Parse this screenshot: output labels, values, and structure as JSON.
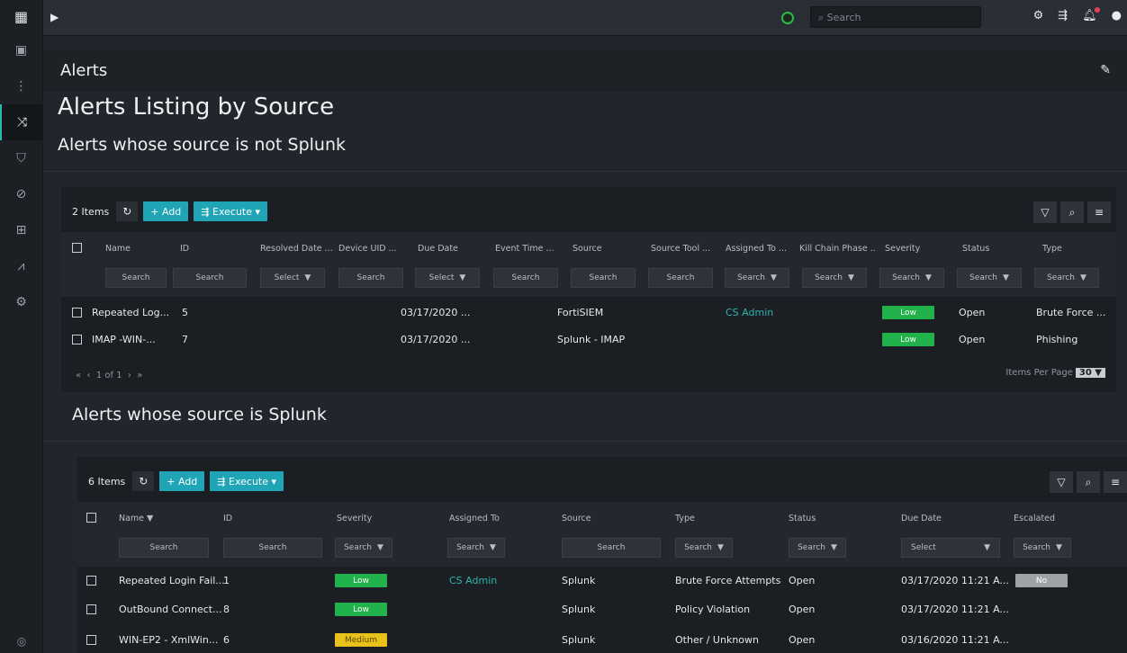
{
  "topbar": {
    "search_placeholder": "Search"
  },
  "page": {
    "title": "Alerts",
    "heading": "Alerts Listing by Source",
    "section1": "Alerts whose source is not Splunk",
    "section2": "Alerts whose source is Splunk"
  },
  "grid1": {
    "count": "2 Items",
    "add_label": "+ Add",
    "execute_label": "Execute ▾",
    "columns": [
      "Name",
      "ID",
      "Resolved Date ...",
      "Device UID ...",
      "Due Date",
      "Event Time ...",
      "Source",
      "Source Tool ...",
      "Assigned To ...",
      "Kill Chain Phase ..",
      "Severity",
      "Status",
      "Type"
    ],
    "filters": [
      "Search",
      "Search",
      "Select",
      "Search",
      "Select",
      "Search",
      "Search",
      "Search",
      "Search",
      "Search",
      "Search",
      "Search",
      "Search"
    ],
    "rows": [
      {
        "name": "Repeated Log...",
        "id": "5",
        "due": "03/17/2020 ...",
        "source": "FortiSIEM",
        "assigned": "CS Admin",
        "severity": "Low",
        "status": "Open",
        "type": "Brute Force ..."
      },
      {
        "name": "IMAP -WIN-...",
        "id": "7",
        "due": "03/17/2020 ...",
        "source": "Splunk - IMAP",
        "assigned": "",
        "severity": "Low",
        "status": "Open",
        "type": "Phishing"
      }
    ],
    "pager": "1 of 1",
    "items_per_page_label": "Items Per Page",
    "items_per_page": "30"
  },
  "grid2": {
    "count": "6 Items",
    "add_label": "+ Add",
    "execute_label": "Execute ▾",
    "columns": [
      "Name",
      "ID",
      "Severity",
      "Assigned To",
      "Source",
      "Type",
      "Status",
      "Due Date",
      "Escalated"
    ],
    "filters": [
      "Search",
      "Search",
      "Search",
      "Search",
      "Search",
      "Search",
      "Search",
      "Select",
      "Search"
    ],
    "rows": [
      {
        "name": "Repeated Login Fail...",
        "id": "1",
        "severity": "Low",
        "assigned": "CS Admin",
        "source": "Splunk",
        "type": "Brute Force Attempts",
        "status": "Open",
        "due": "03/17/2020 11:21 A...",
        "escalated": "No"
      },
      {
        "name": "OutBound Connect...",
        "id": "8",
        "severity": "Low",
        "assigned": "",
        "source": "Splunk",
        "type": "Policy Violation",
        "status": "Open",
        "due": "03/17/2020 11:21 A...",
        "escalated": ""
      },
      {
        "name": "WIN-EP2 - XmlWin...",
        "id": "6",
        "severity": "Medium",
        "assigned": "",
        "source": "Splunk",
        "type": "Other / Unknown",
        "status": "Open",
        "due": "03/16/2020 11:21 A...",
        "escalated": ""
      }
    ]
  },
  "colors": {
    "accent": "#1fa5b6",
    "low": "#22b24c",
    "medium": "#e8c21a",
    "no": "#9ea3a8"
  }
}
